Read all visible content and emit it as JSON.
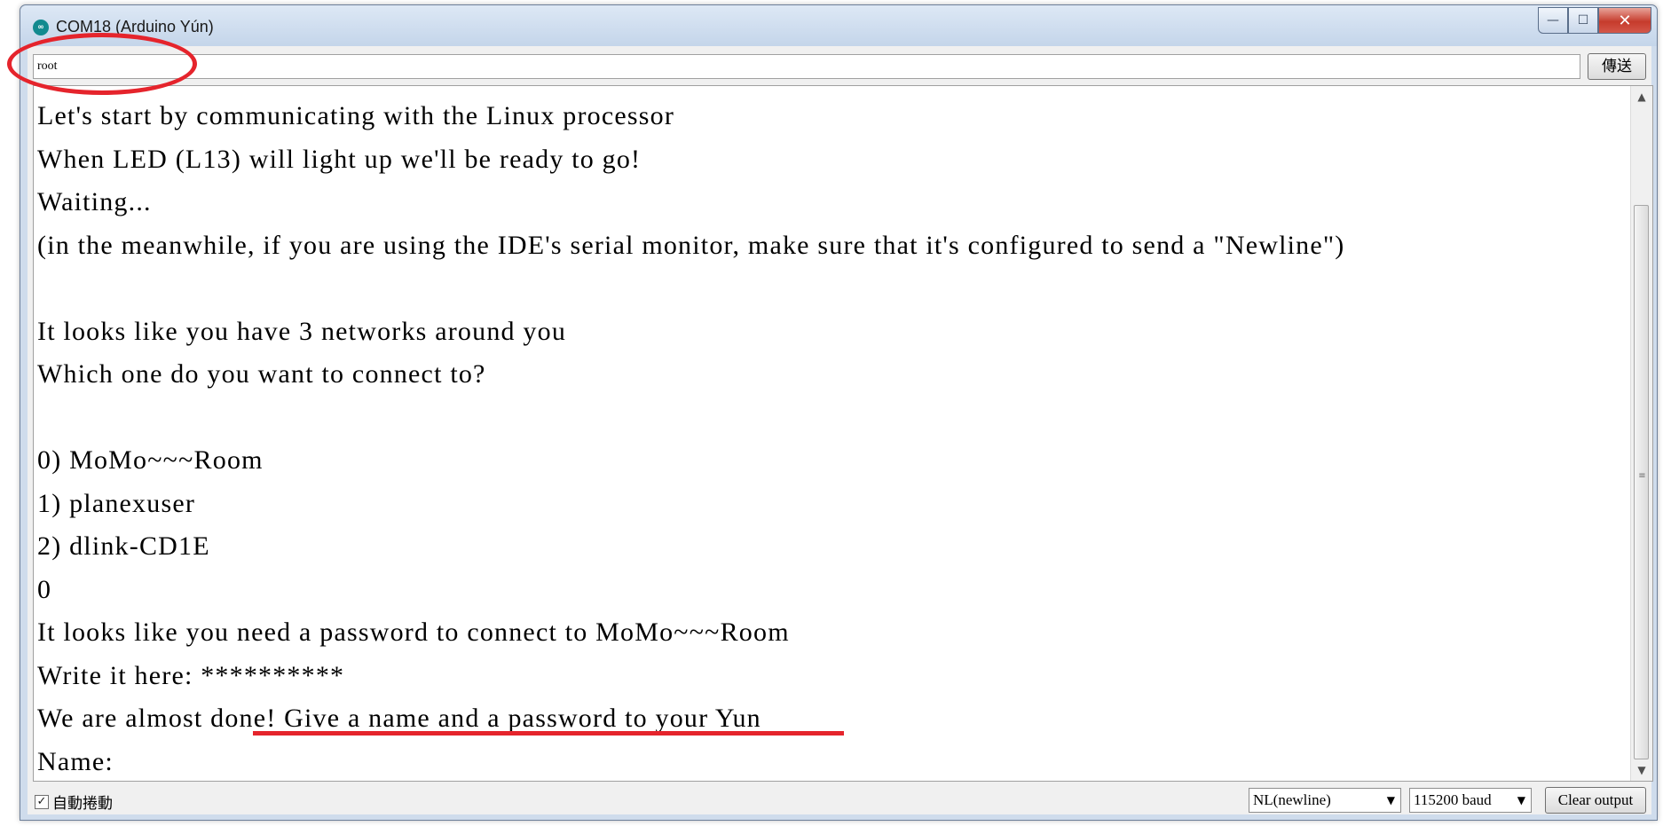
{
  "window": {
    "title": "COM18 (Arduino Yún)",
    "icon": "arduino-icon",
    "controls": {
      "minimize": "—",
      "maximize": "☐",
      "close": "✕"
    }
  },
  "send_bar": {
    "input_value": "root",
    "send_label": "傳送"
  },
  "output": {
    "lines": [
      "Let's start by communicating with the Linux processor",
      "When LED (L13) will light up we'll be ready to go!",
      "Waiting...",
      "(in the meanwhile, if you are using the IDE's serial monitor, make sure that it's configured to send a \"Newline\")",
      "",
      "It looks like you have 3 networks around you",
      "Which one do you want to connect to?",
      "",
      "0) MoMo~~~Room",
      "1) planexuser",
      "2) dlink-CD1E",
      "0",
      "It looks like you need a password to connect to MoMo~~~Room",
      "Write it here: **********",
      "We are almost done! Give a name and a password to your Yun",
      "Name:"
    ]
  },
  "footer": {
    "autoscroll_label": "自動捲動",
    "autoscroll_checked": true,
    "line_ending": "NL(newline)",
    "baud_rate": "115200 baud",
    "clear_label": "Clear output"
  },
  "annotations": {
    "color": "#e5242c"
  }
}
